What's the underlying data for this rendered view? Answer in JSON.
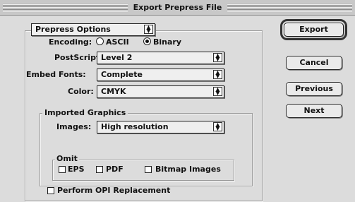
{
  "window": {
    "title": "Export Prepress File"
  },
  "section_popup": {
    "value": "Prepress Options"
  },
  "encoding": {
    "label": "Encoding:",
    "options": [
      "ASCII",
      "Binary"
    ],
    "selected": "Binary"
  },
  "postscript": {
    "label": "PostScript:",
    "value": "Level 2"
  },
  "embed_fonts": {
    "label": "Embed Fonts:",
    "value": "Complete"
  },
  "color": {
    "label": "Color:",
    "value": "CMYK"
  },
  "imported_graphics": {
    "title": "Imported Graphics",
    "images_label": "Images:",
    "images_value": "High resolution",
    "omit": {
      "title": "Omit",
      "eps": "EPS",
      "pdf": "PDF",
      "bitmap": "Bitmap Images"
    },
    "opi": "Perform OPI Replacement"
  },
  "buttons": {
    "export": "Export",
    "cancel": "Cancel",
    "previous": "Previous",
    "next": "Next"
  }
}
